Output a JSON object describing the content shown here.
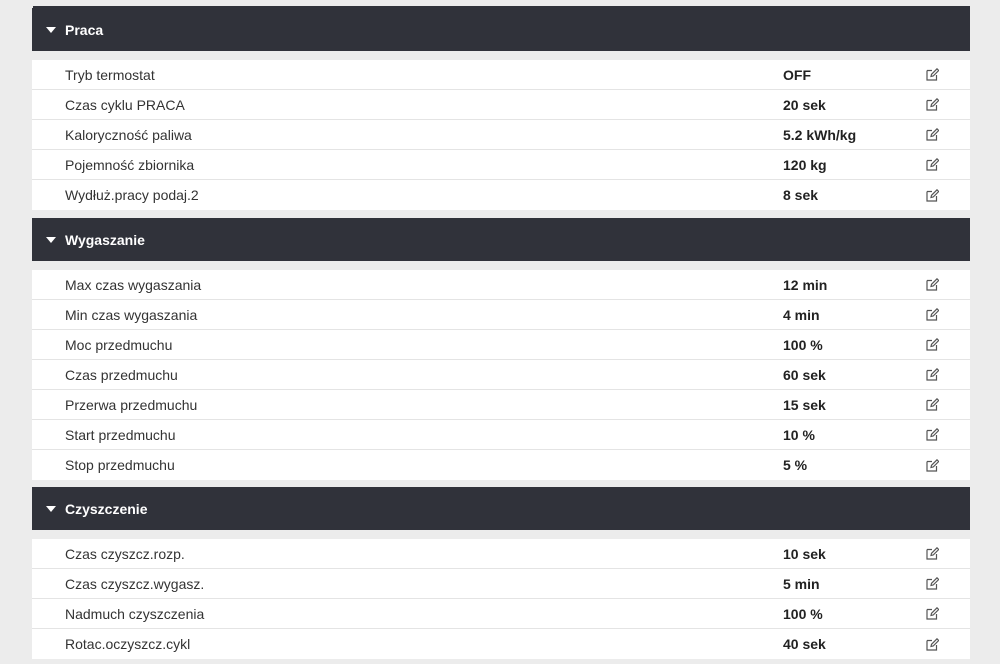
{
  "sections": [
    {
      "title": "Praca",
      "rows": [
        {
          "label": "Tryb termostat",
          "value": "OFF"
        },
        {
          "label": "Czas cyklu PRACA",
          "value": "20 sek"
        },
        {
          "label": "Kaloryczność paliwa",
          "value": "5.2 kWh/kg"
        },
        {
          "label": "Pojemność zbiornika",
          "value": "120 kg"
        },
        {
          "label": "Wydłuż.pracy podaj.2",
          "value": "8 sek"
        }
      ]
    },
    {
      "title": "Wygaszanie",
      "rows": [
        {
          "label": "Max czas wygaszania",
          "value": "12 min"
        },
        {
          "label": "Min czas wygaszania",
          "value": "4 min"
        },
        {
          "label": "Moc przedmuchu",
          "value": "100 %"
        },
        {
          "label": "Czas przedmuchu",
          "value": "60 sek"
        },
        {
          "label": "Przerwa przedmuchu",
          "value": "15 sek"
        },
        {
          "label": "Start przedmuchu",
          "value": "10 %"
        },
        {
          "label": "Stop przedmuchu",
          "value": "5 %"
        }
      ]
    },
    {
      "title": "Czyszczenie",
      "rows": [
        {
          "label": "Czas czyszcz.rozp.",
          "value": "10 sek"
        },
        {
          "label": "Czas czyszcz.wygasz.",
          "value": "5 min"
        },
        {
          "label": "Nadmuch czyszczenia",
          "value": "100 %"
        },
        {
          "label": "Rotac.oczyszcz.cykl",
          "value": "40 sek"
        }
      ]
    }
  ],
  "icons": {
    "collapse": "caret-down-icon",
    "edit": "edit-icon"
  },
  "colors": {
    "header_bg": "#30323a",
    "header_text": "#ffffff",
    "page_bg": "#ececec",
    "row_bg": "#ffffff"
  }
}
